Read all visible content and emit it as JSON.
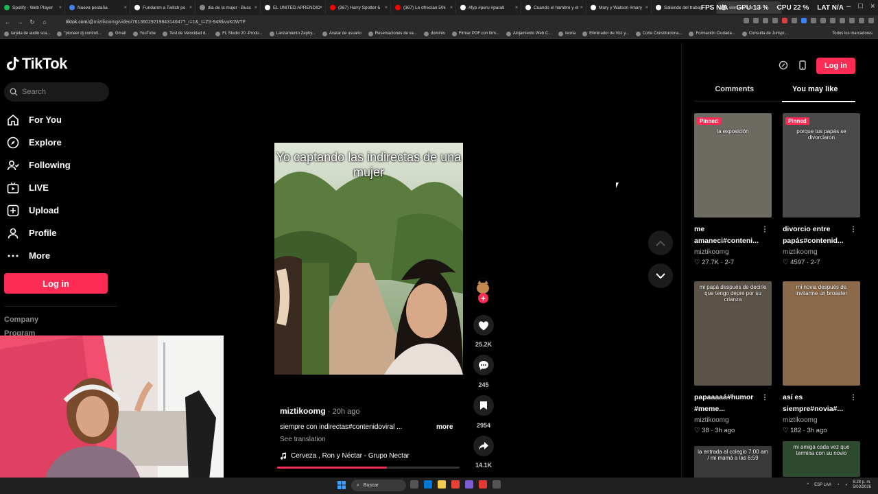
{
  "browser": {
    "tabs": [
      {
        "title": "Spotify - Web Player",
        "color": "#1db954"
      },
      {
        "title": "Nueva pestaña",
        "color": "#4285f4"
      },
      {
        "title": "Fundaron a Twitch po",
        "color": "#ffffff"
      },
      {
        "title": "dia de la mujer - Busc",
        "color": "#888888"
      },
      {
        "title": "EL UNITED APRENDIO",
        "color": "#ffffff"
      },
      {
        "title": "(367) Harry Spotter 6",
        "color": "#ff0000"
      },
      {
        "title": "(367) Le ofrecían 50k",
        "color": "#ff0000"
      },
      {
        "title": "#fyp #peru #parati",
        "color": "#ffffff"
      },
      {
        "title": "Cuando el hambre y el",
        "color": "#ffffff"
      },
      {
        "title": "Mary y Watson #mary",
        "color": "#ffffff"
      },
      {
        "title": "Saliendo del trabajo",
        "color": "#ffffff"
      },
      {
        "title": "siempre con indi",
        "color": "#ffffff"
      }
    ],
    "overlay_stats": {
      "fps": "FPS",
      "fps_val": "N/A",
      "gpu": "GPU",
      "gpu_val": "13 %",
      "cpu": "CPU",
      "cpu_val": "22 %",
      "lat": "LAT",
      "lat_val": "N/A"
    },
    "url_host": "tiktok.com",
    "url_path": "/@miztikoomg/video/7613602921984314647?_r=1&_t=ZS-94RkvuK0WTF",
    "bookmarks": [
      "tarjeta de audio sca...",
      "\"pioneer dj controll...",
      "Gmail",
      "YouTube",
      "Test de Velocidad d...",
      "FL Studio 20 -Produ...",
      "Lanzamiento Zephy...",
      "Avatar de usuario",
      "Reservaciones de va...",
      "dominio",
      "Firmar PDF con firm...",
      "Alojamiento Web C...",
      "teoria",
      "Eliminador de Voz y...",
      "Corte Constituciona...",
      "Formación Ciudada...",
      "Consulta de Jurispr..."
    ],
    "bookmarks_all": "Todos los marcadores"
  },
  "sidebar": {
    "logo": "TikTok",
    "search_placeholder": "Search",
    "items": [
      {
        "label": "For You",
        "icon": "home-icon"
      },
      {
        "label": "Explore",
        "icon": "compass-icon"
      },
      {
        "label": "Following",
        "icon": "following-icon"
      },
      {
        "label": "LIVE",
        "icon": "live-icon"
      },
      {
        "label": "Upload",
        "icon": "upload-icon"
      },
      {
        "label": "Profile",
        "icon": "profile-icon"
      },
      {
        "label": "More",
        "icon": "more-icon"
      }
    ],
    "login": "Log in",
    "footer": [
      "Company",
      "Program"
    ]
  },
  "video": {
    "caption": "Yo captando las indirectas de una mujer",
    "author": "miztikoomg",
    "ago": "· 20h ago",
    "description": "siempre con indirectas#contenidoviral ...",
    "more": "more",
    "translation": "See translation",
    "music": "Cerveza , Ron y Néctar - Grupo Nectar",
    "progress": 0.6,
    "likes": "25.2K",
    "comments": "245",
    "saves": "2954",
    "shares": "14.1K"
  },
  "right": {
    "login": "Log in",
    "tabs": [
      "Comments",
      "You may like"
    ],
    "cards": [
      {
        "caption": "la exposición",
        "pinned": "Pinned",
        "title": "me amaneci#conteni...",
        "author": "miztikoomg",
        "likes": "27.7K",
        "date": "2-7",
        "bg": "#6d6a62"
      },
      {
        "caption": "porque tus papás se divorciaron",
        "pinned": "Pinned",
        "title": "divorcio entre papás#contenid...",
        "author": "miztikoomg",
        "likes": "4597",
        "date": "2-7",
        "bg": "#4a4a4a"
      },
      {
        "caption": "mi papá después de decirle que tengo depre por su crianza",
        "pinned": "",
        "title": "papaaaaá#humor #meme...",
        "author": "miztikoomg",
        "likes": "38",
        "date": "3h ago",
        "bg": "#5c5448"
      },
      {
        "caption": "mi novia después de invitarme un broaster",
        "pinned": "",
        "title": "así es siempre#novia#...",
        "author": "miztikoomg",
        "likes": "182",
        "date": "3h ago",
        "bg": "#8a6a4a"
      },
      {
        "caption": "la entrada al colegio 7:00 am / mi mamá a las 6:59",
        "pinned": "",
        "title": "",
        "author": "",
        "likes": "",
        "date": "",
        "bg": "#3a3a3a"
      },
      {
        "caption": "mi amiga cada vez que termina con su novio",
        "pinned": "",
        "title": "",
        "author": "",
        "likes": "",
        "date": "",
        "bg": "#2e4a2e"
      }
    ]
  },
  "taskbar": {
    "search": "Buscar",
    "lang": "ESP LAA",
    "time": "6:28 p. m.",
    "date": "5/03/2026"
  }
}
